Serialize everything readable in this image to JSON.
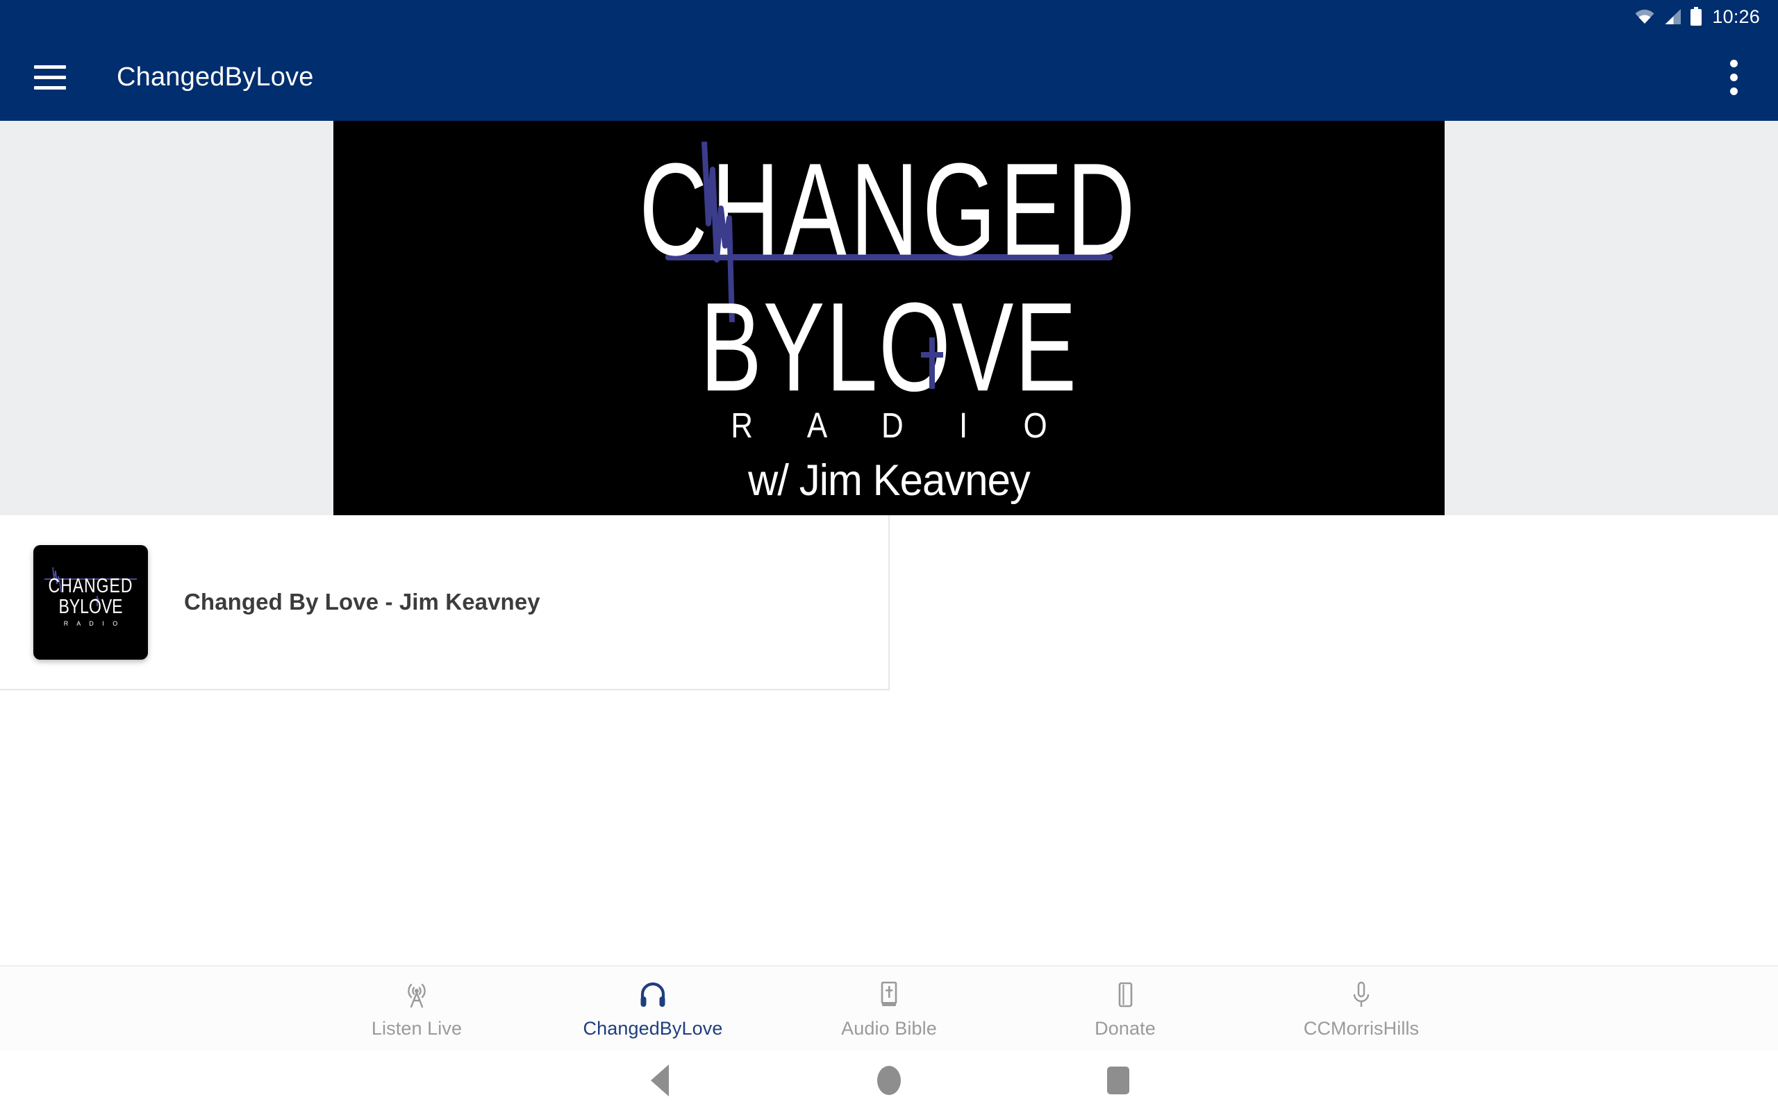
{
  "status_bar": {
    "time": "10:26",
    "icons": [
      "wifi-icon",
      "cellular-signal-icon",
      "battery-icon"
    ]
  },
  "app_bar": {
    "title": "ChangedByLove",
    "menu_icon": "hamburger-menu-icon",
    "overflow_icon": "overflow-menu-icon",
    "background_color": "#002E6E"
  },
  "banner": {
    "logo_line1": "CHANGED",
    "logo_line2": "BYLOVE",
    "logo_line3": "R A D I O",
    "host_line": "w/ Jim Keavney",
    "background_color": "#000000",
    "accent_color": "#3C3C8C",
    "surround_color": "#ECEEEF"
  },
  "episodes": [
    {
      "title": "Changed By Love - Jim Keavney",
      "thumbnail_line1": "CHANGED",
      "thumbnail_line2": "BYLOVE",
      "thumbnail_line3": "R A D I O"
    }
  ],
  "bottom_nav": {
    "active_color": "#1F3E7E",
    "inactive_color": "#9A9A9A",
    "items": [
      {
        "label": "Listen Live",
        "icon": "broadcast-tower-icon",
        "active": false
      },
      {
        "label": "ChangedByLove",
        "icon": "headphones-icon",
        "active": true
      },
      {
        "label": "Audio Bible",
        "icon": "bible-book-icon",
        "active": false
      },
      {
        "label": "Donate",
        "icon": "card-icon",
        "active": false
      },
      {
        "label": "CCMorrisHills",
        "icon": "microphone-icon",
        "active": false
      }
    ]
  },
  "system_nav": {
    "back": "back-triangle-icon",
    "home": "home-circle-icon",
    "recents": "recents-square-icon"
  }
}
